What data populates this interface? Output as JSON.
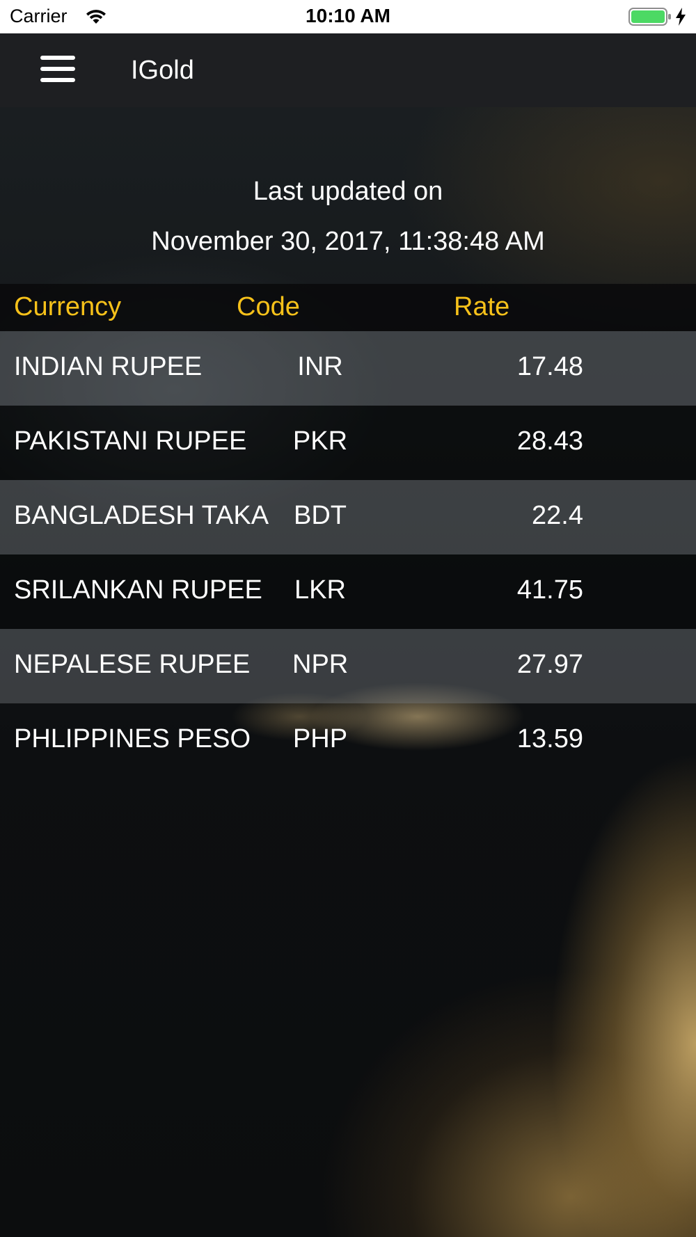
{
  "status_bar": {
    "carrier": "Carrier",
    "time": "10:10 AM",
    "wifi_icon": "wifi-icon",
    "battery_icon": "battery-icon",
    "charging_icon": "bolt-icon"
  },
  "nav": {
    "menu_icon": "hamburger-menu-icon",
    "title": "IGold"
  },
  "updated": {
    "label": "Last updated on",
    "date": "November 30, 2017, 11:38:48 AM"
  },
  "table": {
    "headers": {
      "currency": "Currency",
      "code": "Code",
      "rate": "Rate"
    },
    "rows": [
      {
        "currency": "INDIAN RUPEE",
        "code": "INR",
        "rate": "17.48"
      },
      {
        "currency": "PAKISTANI RUPEE",
        "code": "PKR",
        "rate": "28.43"
      },
      {
        "currency": "BANGLADESH TAKA",
        "code": "BDT",
        "rate": "22.4"
      },
      {
        "currency": "SRILANKAN RUPEE",
        "code": "LKR",
        "rate": "41.75"
      },
      {
        "currency": "NEPALESE RUPEE",
        "code": "NPR",
        "rate": "27.97"
      },
      {
        "currency": "PHLIPPINES PESO",
        "code": "PHP",
        "rate": "13.59"
      }
    ]
  },
  "colors": {
    "accent": "#f6c11a",
    "nav_background": "#1e1f22",
    "text": "#ffffff"
  }
}
